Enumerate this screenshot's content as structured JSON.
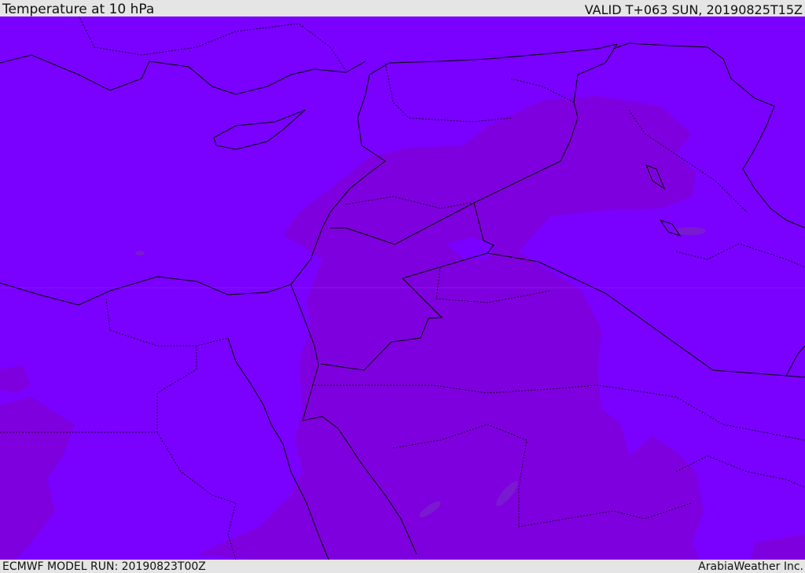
{
  "header": {
    "title": "Temperature at 10 hPa",
    "valid": "VALID T+063 SUN, 20190825T15Z"
  },
  "footer": {
    "model_run": "ECMWF MODEL RUN: 20190823T00Z",
    "brand": "ArabiaWeather Inc."
  },
  "colors": {
    "base_field": "#7a00ff",
    "warmer_field": "#7f00de",
    "spot_field": "#7a1ad0",
    "coastline": "#000000"
  }
}
